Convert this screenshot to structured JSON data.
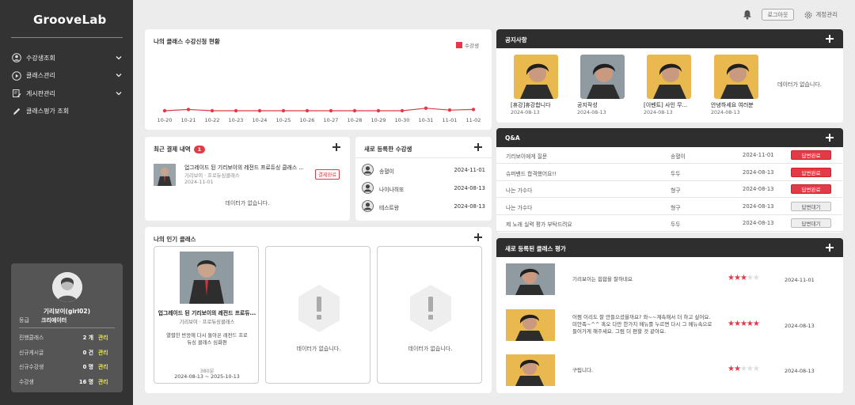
{
  "sidebar": {
    "logo": "GrooveLab",
    "items": [
      {
        "label": "수강생조회",
        "icon": "user-circle-icon",
        "expand": true
      },
      {
        "label": "클래스관리",
        "icon": "play-circle-icon",
        "expand": true
      },
      {
        "label": "게시판관리",
        "icon": "edit-board-icon",
        "expand": true
      },
      {
        "label": "클래스평가 조회",
        "icon": "pencil-icon",
        "expand": false
      }
    ],
    "profile": {
      "name": "기리보이(girl02)",
      "role_label": "등급",
      "role_value": "크리에이터",
      "manage_label": "관리",
      "stats": [
        {
          "label": "진행클래스",
          "value": "2 개"
        },
        {
          "label": "신규게시글",
          "value": "0 건"
        },
        {
          "label": "신규수강생",
          "value": "0 명"
        },
        {
          "label": "수강생",
          "value": "16 명"
        }
      ]
    }
  },
  "topbar": {
    "logout": "로그아웃",
    "account": "계정관리"
  },
  "chart_panel": {
    "title": "나의 클래스 수강신청 현황",
    "chart_data": {
      "type": "line",
      "categories": [
        "10-20",
        "10-21",
        "10-22",
        "10-23",
        "10-24",
        "10-25",
        "10-26",
        "10-27",
        "10-28",
        "10-29",
        "10-30",
        "10-31",
        "11-01",
        "11-02"
      ],
      "series": [
        {
          "name": "수강생",
          "values": [
            0,
            0.2,
            0,
            0,
            0,
            0,
            0,
            0,
            0,
            0,
            0,
            0.4,
            0.1,
            0.2
          ],
          "color": "#e23a46"
        }
      ],
      "legend": "top-right",
      "grid": false
    }
  },
  "payments": {
    "title": "최근 결제 내역",
    "count": "1",
    "item": {
      "title": "업그레이드 된 기리보이의 레전드 프로듀싱 클래스 ...",
      "sub": "기리보이 · 프로듀싱클래스",
      "date": "2024-11-01",
      "status": "결제완료"
    },
    "empty": "데이터가 없습니다."
  },
  "new_students": {
    "title": "새로 등록한 수강생",
    "items": [
      {
        "name": "송혈이",
        "date": "2024-11-01"
      },
      {
        "name": "나이나히또",
        "date": "2024-08-13"
      },
      {
        "name": "테스트왕",
        "date": "2024-08-13"
      }
    ]
  },
  "popular": {
    "title": "나의 인기 클래스",
    "card": {
      "title": "업그레이드 된 기리보이의 레전드 프로듀...",
      "sub": "기리보이 · 프로듀싱클래스",
      "desc": "열렬한 반응에 다시 돌아온 레전드 프로듀싱 클래스 심화편",
      "price": "380분",
      "period": "2024-08-13 ~ 2025-10-13"
    },
    "empty": "데이터가 없습니다."
  },
  "notices": {
    "title": "공지사항",
    "items": [
      {
        "title": "[휴강]휴강합니다",
        "date": "2024-08-13"
      },
      {
        "title": "공지작성",
        "date": "2024-08-13"
      },
      {
        "title": "[이벤트] 사인 무...",
        "date": "2024-08-13"
      },
      {
        "title": "안녕하세요 여러분",
        "date": "2024-08-13"
      }
    ],
    "empty": "데이터가 없습니다."
  },
  "qa": {
    "title": "Q&A",
    "rows": [
      {
        "q": "기리보이에게 질문",
        "user": "송혈이",
        "date": "2024-11-01",
        "status": "답변완료",
        "done": true
      },
      {
        "q": "슈퍼밴드 합격했어요!!",
        "user": "두두",
        "date": "2024-08-13",
        "status": "답변완료",
        "done": true
      },
      {
        "q": "나는 가수다",
        "user": "형구",
        "date": "2024-08-13",
        "status": "답변완료",
        "done": true
      },
      {
        "q": "나는 가수다",
        "user": "형구",
        "date": "2024-08-13",
        "status": "답변대기",
        "done": false
      },
      {
        "q": "제 노래 실력 평가 부탁드려요",
        "user": "두두",
        "date": "2024-08-13",
        "status": "답변대기",
        "done": false
      }
    ]
  },
  "reviews": {
    "title": "새로 등록된 클래스 평가",
    "items": [
      {
        "text": "기리보이는 힙합을 잘하네요",
        "rating": 3,
        "date": "2024-11-01"
      },
      {
        "text": "어쩜 이리도 잘 만들으셨을까요? 와~~계속해서 더 하고 싶어요. 미안족~^^ 혹오 다만 한가지 메뉴를 누르면 다시 그 메뉴속으로 들어가게 해주세요. 그럼 더 편할 것 같아요.",
        "rating": 5,
        "date": "2024-08-13"
      },
      {
        "text": "구립니다.",
        "rating": 2,
        "date": "2024-08-13"
      }
    ]
  }
}
